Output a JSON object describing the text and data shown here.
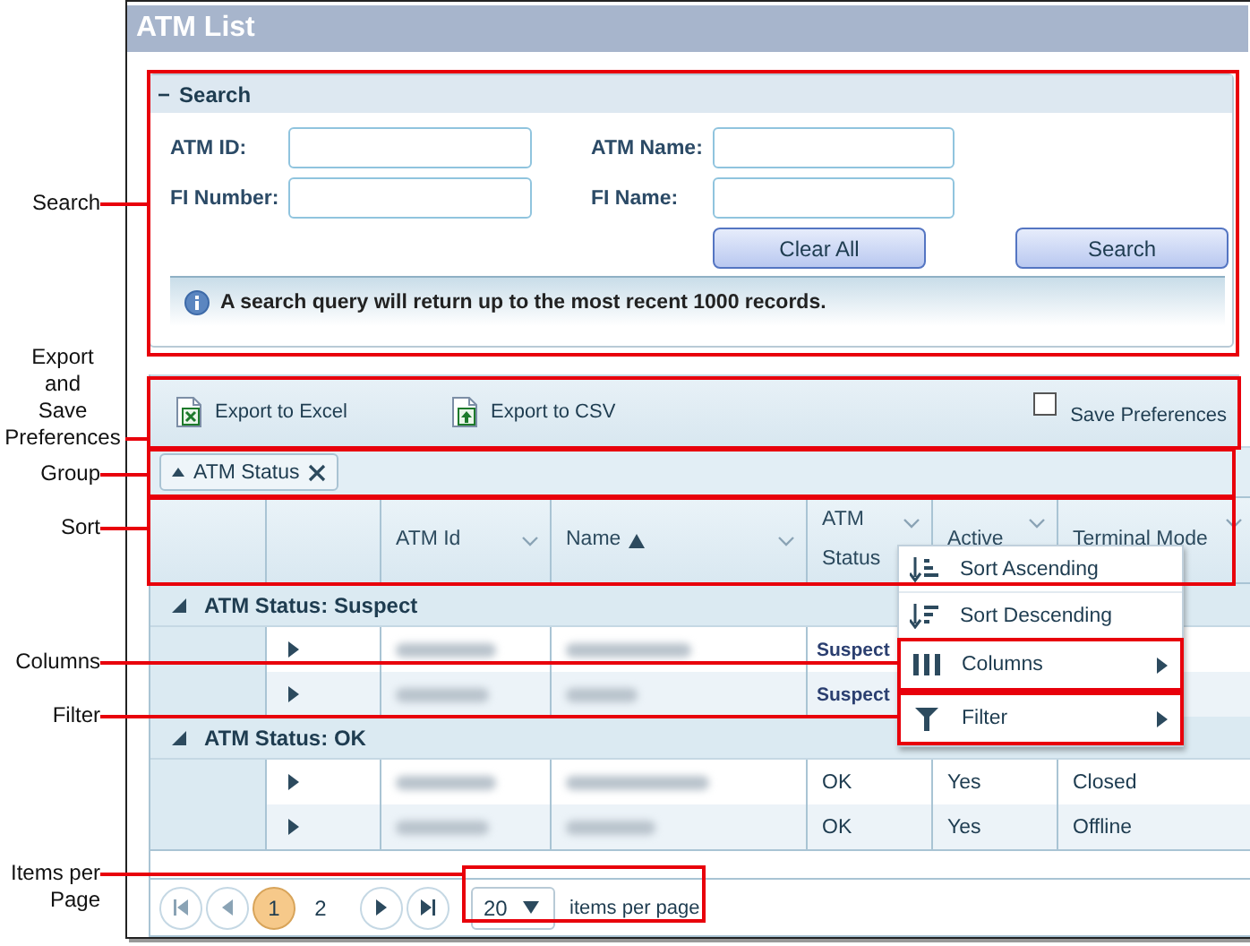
{
  "window": {
    "title": "ATM List"
  },
  "search": {
    "toggle": "−",
    "title": "Search",
    "fields": [
      {
        "label": "ATM ID:"
      },
      {
        "label": "ATM Name:"
      },
      {
        "label": "FI Number:"
      },
      {
        "label": "FI Name:"
      }
    ],
    "buttons": [
      "Clear All",
      "Search"
    ],
    "info": "A search query will return up to the most recent 1000 records."
  },
  "toolbar": {
    "exports": [
      {
        "label": "Export to Excel",
        "kind": "excel"
      },
      {
        "label": "Export to CSV",
        "kind": "csv"
      }
    ],
    "save_preferences": {
      "label": "Save Preferences",
      "checked": false
    }
  },
  "group_chips": [
    {
      "label": "ATM Status",
      "ascending": true
    }
  ],
  "table": {
    "columns": [
      {
        "label": "ATM Id",
        "sorted": false
      },
      {
        "label": "Name",
        "sorted": true
      },
      {
        "label": "ATM Status",
        "sorted": false
      },
      {
        "label": "Active",
        "sorted": false
      },
      {
        "label": "Terminal Mode",
        "sorted": false
      }
    ],
    "groups": [
      {
        "label": "ATM Status: Suspect",
        "expanded": true,
        "rows": [
          {
            "redacted": true,
            "bold_status": true,
            "cells": [
              "Suspect"
            ]
          },
          {
            "redacted": true,
            "bold_status": true,
            "cells": [
              "Suspect"
            ]
          }
        ]
      },
      {
        "label": "ATM Status: OK",
        "expanded": true,
        "rows": [
          {
            "redacted": true,
            "bold_status": false,
            "cells": [
              "OK",
              "Yes",
              "Closed"
            ]
          },
          {
            "redacted": true,
            "bold_status": false,
            "cells": [
              "OK",
              "Yes",
              "Offline"
            ]
          }
        ]
      }
    ]
  },
  "column_menu": {
    "items": [
      {
        "label": "Sort Ascending",
        "kind": "sort-asc",
        "submenu": false
      },
      {
        "label": "Sort Descending",
        "kind": "sort-desc",
        "submenu": false
      },
      {
        "label": "Columns",
        "kind": "columns",
        "submenu": true
      },
      {
        "label": "Filter",
        "kind": "filter",
        "submenu": true
      }
    ]
  },
  "pager": {
    "pages": [
      {
        "label": "1",
        "selected": true
      },
      {
        "label": "2",
        "selected": false
      }
    ],
    "page_size": "20",
    "page_size_label": "items per page"
  },
  "callouts": [
    {
      "label": "Search"
    },
    {
      "label": "Export and Save Preferences"
    },
    {
      "label": "Group"
    },
    {
      "label": "Sort"
    },
    {
      "label": "Columns"
    },
    {
      "label": "Filter"
    },
    {
      "label": "Items per Page"
    }
  ]
}
